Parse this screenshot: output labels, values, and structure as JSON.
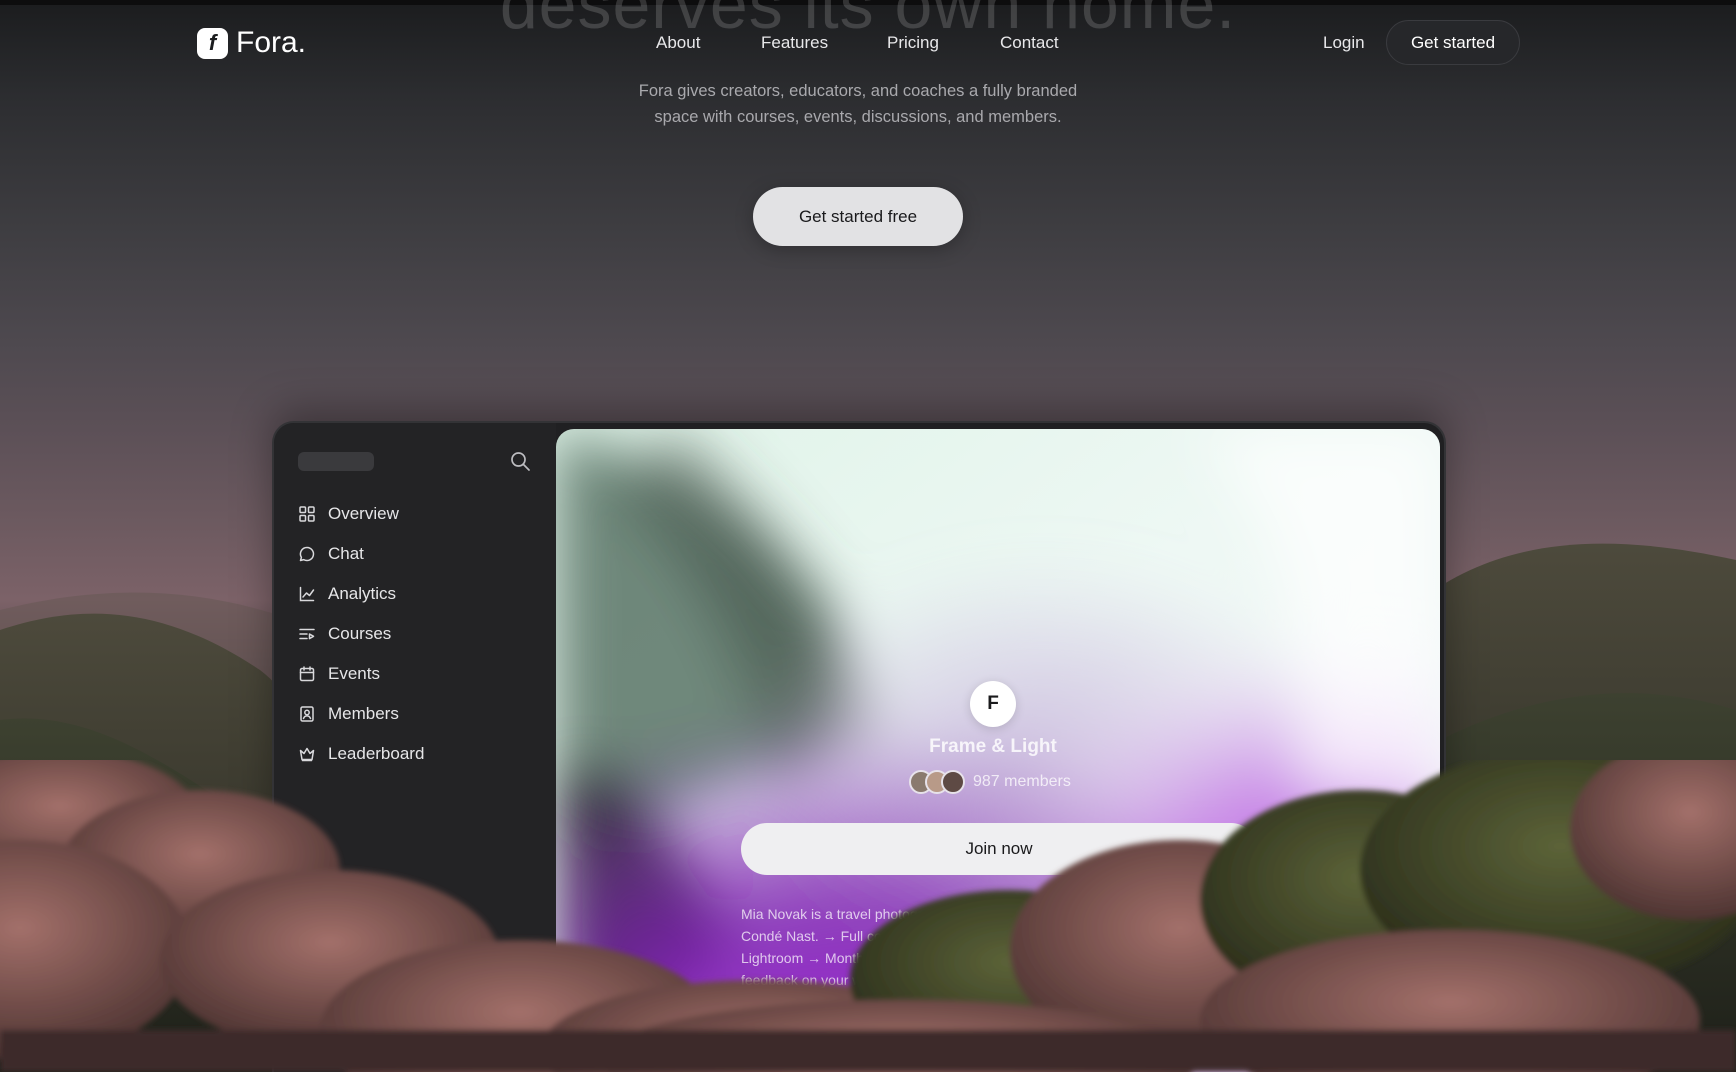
{
  "hero": {
    "ghost_heading": "deserves its own home.",
    "subtitle_line1": "Fora gives creators, educators, and coaches a fully branded",
    "subtitle_line2": "space with courses, events, discussions, and members.",
    "cta_label": "Get started free"
  },
  "header": {
    "logo_text": "Fora.",
    "logo_glyph": "f",
    "nav": [
      "About",
      "Features",
      "Pricing",
      "Contact"
    ],
    "login_label": "Login",
    "cta_label": "Get started"
  },
  "app": {
    "sidebar": {
      "items": [
        {
          "label": "Overview",
          "icon": "grid-icon"
        },
        {
          "label": "Chat",
          "icon": "chat-bubble-icon"
        },
        {
          "label": "Analytics",
          "icon": "chart-icon"
        },
        {
          "label": "Courses",
          "icon": "courses-icon"
        },
        {
          "label": "Events",
          "icon": "calendar-icon"
        },
        {
          "label": "Members",
          "icon": "member-card-icon"
        },
        {
          "label": "Leaderboard",
          "icon": "crown-icon"
        }
      ]
    },
    "community": {
      "avatar_letter": "F",
      "name": "Frame & Light",
      "members_count": "987 members",
      "join_label": "Join now",
      "description_lines": [
        "Mia Novak is a travel photographer published in National Geographic and",
        "Condé Nast. → Full courses on composition, light, and post-pro",
        "Lightroom → Monthly photo challenges with pr",
        "feedback on your work fr"
      ]
    }
  },
  "colors": {
    "accent_purple": "#a23ad6",
    "mint": "#cdeedd",
    "page_dark": "#1b1c1e"
  }
}
